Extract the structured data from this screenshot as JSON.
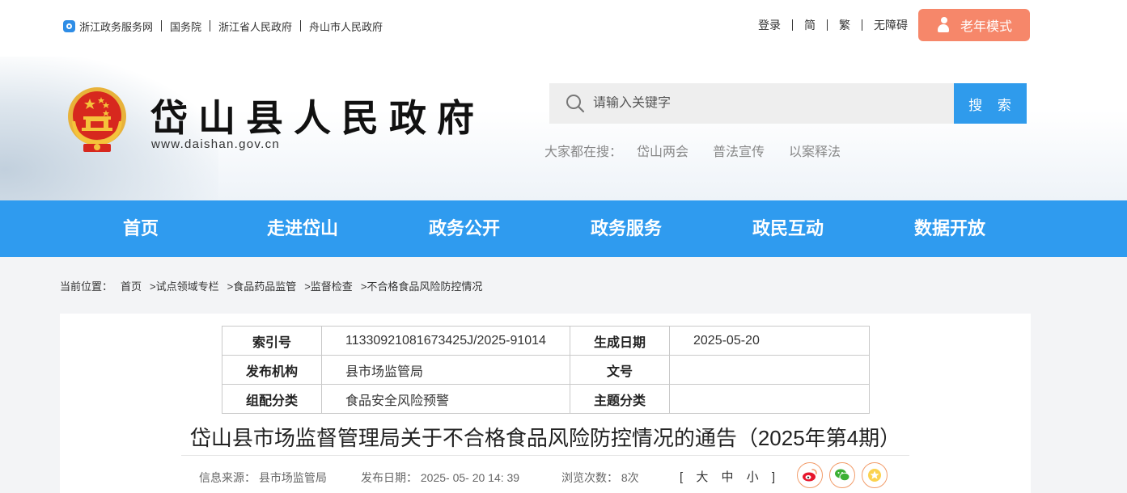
{
  "topbar": {
    "links": [
      "浙江政务服务网",
      "国务院",
      "浙江省人民政府",
      "舟山市人民政府"
    ]
  },
  "topright": {
    "links": [
      "登录",
      "简",
      "繁",
      "无障碍"
    ],
    "elder_mode": "老年模式"
  },
  "site": {
    "title": "岱山县人民政府",
    "url": "www.daishan.gov.cn"
  },
  "search": {
    "placeholder": "请输入关键字",
    "button": "搜 索",
    "hot_label": "大家都在搜：",
    "hot_items": [
      "岱山两会",
      "普法宣传",
      "以案释法"
    ]
  },
  "nav": [
    "首页",
    "走进岱山",
    "政务公开",
    "政务服务",
    "政民互动",
    "数据开放"
  ],
  "breadcrumb": {
    "label": "当前位置：",
    "items": [
      "首页",
      ">试点领域专栏",
      ">食品药品监管",
      ">监督检查",
      ">不合格食品风险防控情况"
    ]
  },
  "meta_table": {
    "rows": [
      {
        "k1": "索引号",
        "v1": "11330921081673425J/2025-91014",
        "k2": "生成日期",
        "v2": "2025-05-20"
      },
      {
        "k1": "发布机构",
        "v1": "县市场监管局",
        "k2": "文号",
        "v2": ""
      },
      {
        "k1": "组配分类",
        "v1": "食品安全风险预警",
        "k2": "主题分类",
        "v2": ""
      }
    ]
  },
  "article": {
    "title": "岱山县市场监督管理局关于不合格食品风险防控情况的通告（2025年第4期）",
    "source": "信息来源： 县市场监管局",
    "date": "发布日期： 2025- 05- 20 14: 39",
    "views": "浏览次数： 8次",
    "font_size": "[ 大 中 小 ]"
  },
  "share": [
    "weibo-icon",
    "wechat-icon",
    "favorite-icon"
  ],
  "colors": {
    "nav_blue": "#2f9bef",
    "search_blue": "#2f9bec",
    "elder_orange": "#f6876a"
  }
}
